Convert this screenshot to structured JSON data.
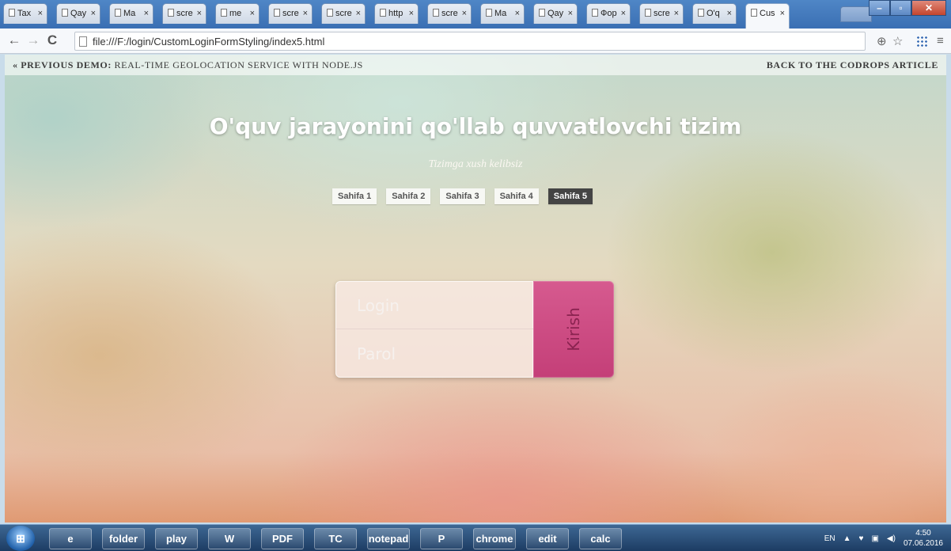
{
  "browser": {
    "tabs": [
      {
        "title": "Tax"
      },
      {
        "title": "Qay"
      },
      {
        "title": "Ma"
      },
      {
        "title": "scre"
      },
      {
        "title": "me"
      },
      {
        "title": "scre"
      },
      {
        "title": "scre"
      },
      {
        "title": "http"
      },
      {
        "title": "scre"
      },
      {
        "title": "Ma"
      },
      {
        "title": "Qay"
      },
      {
        "title": "Фор"
      },
      {
        "title": "scre"
      },
      {
        "title": "O'q"
      },
      {
        "title": "Cus",
        "active": true
      }
    ],
    "url": "file:///F:/login/CustomLoginFormStyling/index5.html"
  },
  "page": {
    "topbar": {
      "prev_label": "« Previous Demo:",
      "prev_text": "Real-Time Geolocation Service with Node.js",
      "back": "Back to the Codrops Article"
    },
    "headline": "O'quv jarayonini qo'llab quvvatlovchi tizim",
    "subtitle": "Tizimga xush kelibsiz",
    "demo_nav": [
      "Sahifa 1",
      "Sahifa 2",
      "Sahifa 3",
      "Sahifa 4",
      "Sahifa 5"
    ],
    "demo_nav_current_index": 4,
    "form": {
      "login_placeholder": "Login",
      "password_placeholder": "Parol",
      "submit": "Kirish"
    }
  },
  "taskbar": {
    "apps": [
      "e",
      "folder",
      "play",
      "W",
      "PDF",
      "TC",
      "notepad",
      "P",
      "chrome",
      "edit",
      "calc"
    ],
    "language": "EN",
    "time": "4:50",
    "date": "07.06.2016"
  }
}
